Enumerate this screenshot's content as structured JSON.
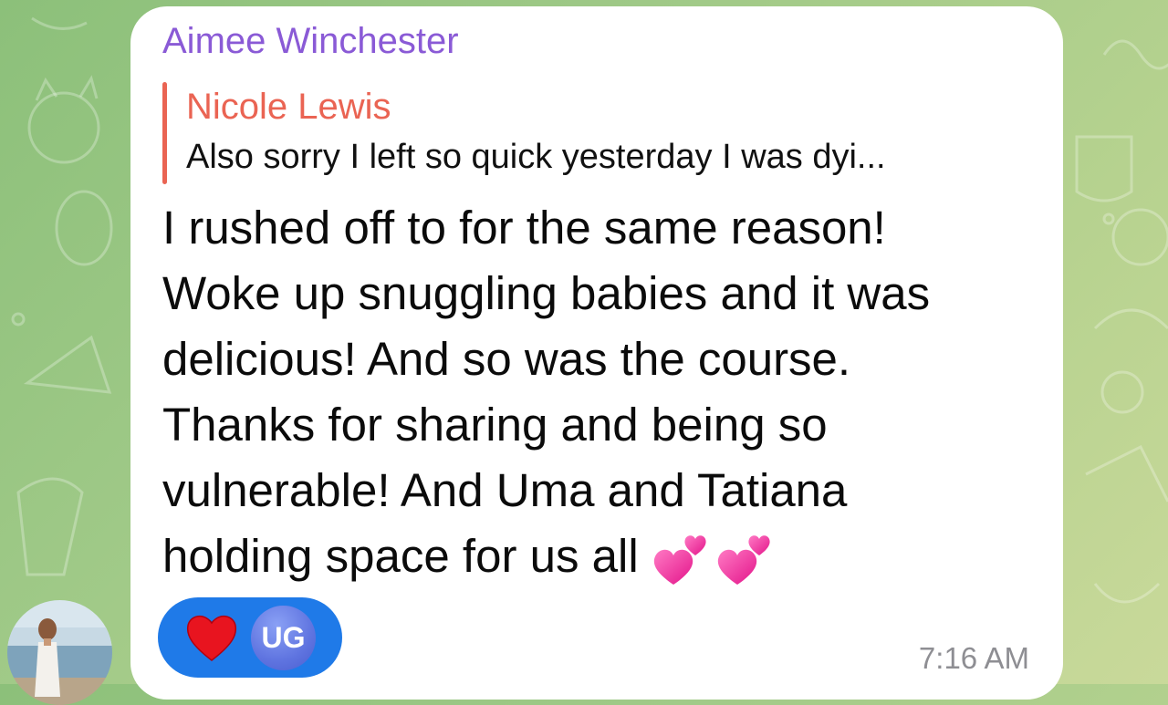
{
  "chat": {
    "sender_name": "Aimee Winchester",
    "reply": {
      "author": "Nicole Lewis",
      "preview": "Also sorry I left so quick yesterday I was dyi..."
    },
    "message_lines": [
      "I rushed off to for the same reason!",
      "Woke up snuggling babies and it was",
      "delicious! And so was the course.",
      "Thanks for sharing and being so",
      "vulnerable! And Uma and Tatiana",
      "holding space for us all"
    ],
    "message_emoji": "two-hearts-emoji",
    "reaction": {
      "emoji": "red-heart-icon",
      "user_initials": "UG"
    },
    "timestamp": "7:16 AM"
  },
  "colors": {
    "sender": "#8a5ad6",
    "reply_accent": "#ea6453",
    "reaction_bg": "#1f7ae8",
    "timestamp": "#8e8e93"
  }
}
